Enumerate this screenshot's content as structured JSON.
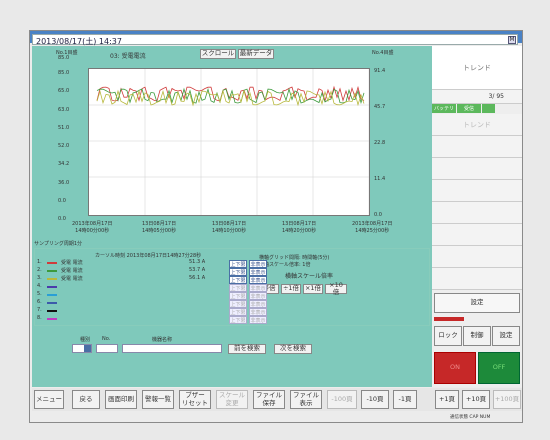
{
  "datetime": "2013/08/17(土) 14:37",
  "top_btn": "M",
  "chart_data": {
    "type": "line",
    "title": "03: 受電電流",
    "channel_no": "No.1目盛",
    "channel_no_right": "No.4目盛",
    "y_left_top": "85.0",
    "y_left_top2": "85.0",
    "y_left_labels": [
      "85.0",
      "65.0",
      "63.0",
      "51.0",
      "52.0",
      "34.2",
      "36.0",
      "0.0",
      "0.0"
    ],
    "y_right_labels": [
      "91.4",
      "45.7",
      "22.8",
      "11.4",
      "0.0"
    ],
    "x_labels": [
      {
        "date": "2013年08月17日",
        "time": "14時00分00秒"
      },
      {
        "date": "13日08月17日",
        "time": "14時05分00秒"
      },
      {
        "date": "13日08月17日",
        "time": "14時10分00秒"
      },
      {
        "date": "13日08月17日",
        "time": "14時20分00秒"
      },
      {
        "date": "2013年08月17日",
        "time": "14時25分00秒"
      }
    ],
    "series": [
      {
        "name": "受電 電流",
        "color": "#d03c3c"
      },
      {
        "name": "受電 電流",
        "color": "#3c9a3c"
      },
      {
        "name": "受電 電流",
        "color": "#b8b83c"
      }
    ]
  },
  "header_buttons": {
    "scroll": "スクロール",
    "latest": "最新データ"
  },
  "sampling": "サンプリング周期1分",
  "cursor": {
    "label": "カーソル時刻  2013年08月17日14時27分28秒",
    "rows": [
      {
        "name": "1. 受電 電流",
        "value": "51.3 A"
      },
      {
        "name": "2. 受電 電流",
        "value": "53.7 A"
      },
      {
        "name": "3. 受電 電流",
        "value": "56.1 A"
      }
    ],
    "up": "上下限",
    "hide": "非表示"
  },
  "scale_info": {
    "grid": "横軸グリッド間隔: 時間軸(5分)",
    "mult": "横軸スケール倍率: 1倍",
    "title": "横軸スケール倍率",
    "btns": [
      "等倍",
      "÷1倍",
      "×1倍",
      "×10倍"
    ]
  },
  "search": {
    "kind": "種別",
    "no": "No.",
    "name": "機器名称",
    "prev": "前を検索",
    "next": "次を検索"
  },
  "bottom": [
    "メニュー",
    "戻る",
    "画面印刷",
    "警報一覧",
    "ブザー\nリセット",
    "スケール\n変更",
    "ファイル\n保存",
    "ファイル\n表示",
    "-100頁",
    "-10頁",
    "-1頁",
    "+1頁",
    "+10頁",
    "+100頁"
  ],
  "right": {
    "title": "トレンド",
    "page": "3/ 95",
    "tag1": "バッテリ",
    "tag2": "受信",
    "title2": "トレンド",
    "setting": "設定",
    "lock": "ロック",
    "control": "制御",
    "set2": "設定",
    "on": "ON",
    "off": "OFF"
  },
  "status": "通信状態 CAP   NUM"
}
